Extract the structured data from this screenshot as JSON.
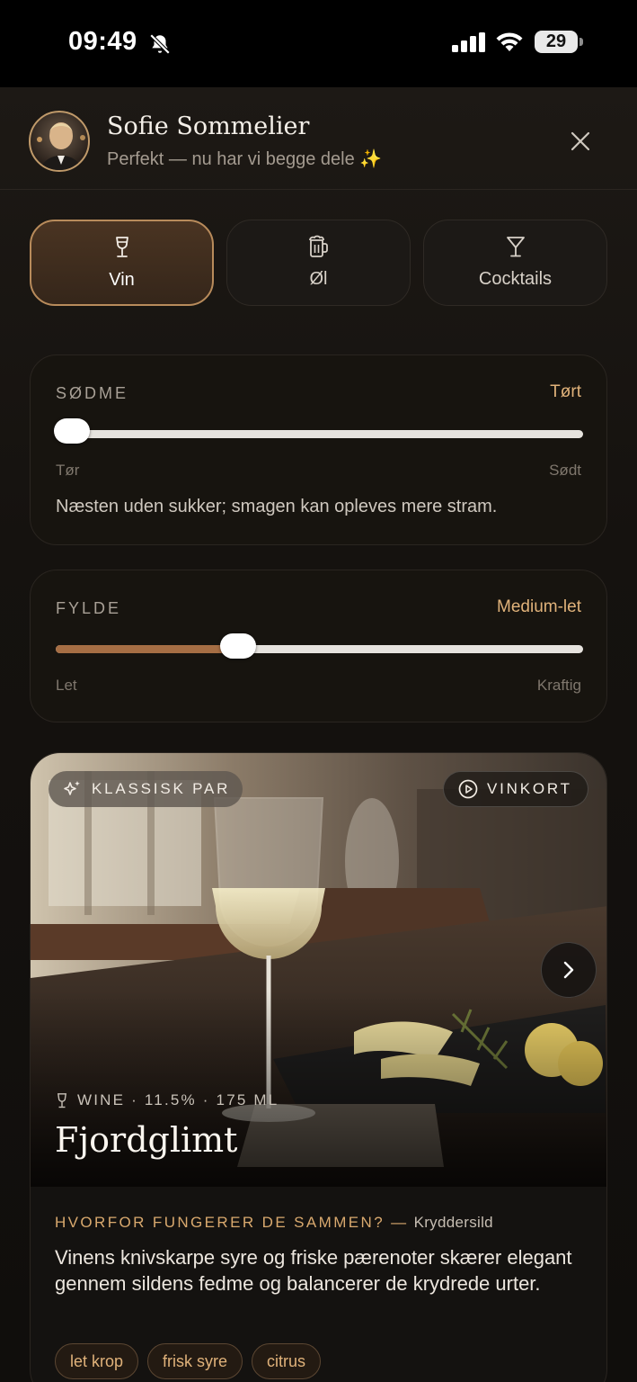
{
  "status_bar": {
    "time": "09:49",
    "battery": "29"
  },
  "header": {
    "name": "Sofie Sommelier",
    "subtitle": "Perfekt — nu har vi begge dele ✨"
  },
  "tabs": [
    {
      "label": "Vin",
      "icon": "wine-glass-icon",
      "active": true
    },
    {
      "label": "Øl",
      "icon": "beer-mug-icon",
      "active": false
    },
    {
      "label": "Cocktails",
      "icon": "cocktail-glass-icon",
      "active": false
    }
  ],
  "sweetness": {
    "title": "SØDME",
    "value": "Tørt",
    "min_label": "Tør",
    "max_label": "Sødt",
    "level": 0.03,
    "description": "Næsten uden sukker; smagen kan opleves mere stram."
  },
  "body": {
    "title": "FYLDE",
    "value": "Medium-let",
    "min_label": "Let",
    "max_label": "Kraftig",
    "level": 0.345
  },
  "pairing": {
    "badge": "KLASSISK PAR",
    "menu_button": "VINKORT",
    "meta": "WINE · 11.5% · 175 ML",
    "name": "Fjordglimt",
    "why_title": "HVORFOR FUNGERER DE SAMMEN? —",
    "dish": "Kryddersild",
    "why_text": "Vinens knivskarpe syre og friske pærenoter skærer elegant gennem sildens fedme og balancerer de krydrede urter.",
    "tags": [
      "let krop",
      "frisk syre",
      "citrus"
    ]
  },
  "colors": {
    "accent": "#e0b27a",
    "fill": "#a66e44",
    "background": "#0e0c0b"
  }
}
